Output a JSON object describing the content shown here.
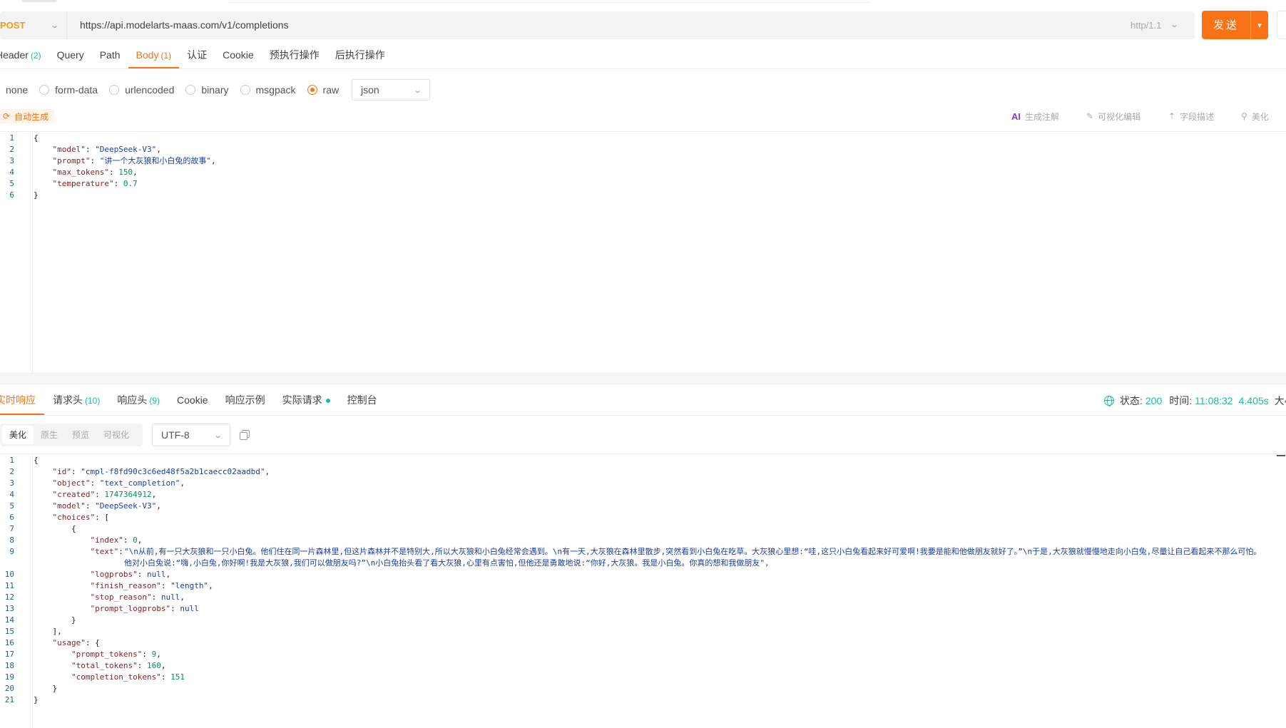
{
  "request": {
    "method": "POST",
    "url": "https://api.modelarts-maas.com/v1/completions",
    "http_version": "http/1.1",
    "send_label": "发送"
  },
  "request_tabs": [
    {
      "label": "Header",
      "count": "(2)"
    },
    {
      "label": "Query",
      "count": ""
    },
    {
      "label": "Path",
      "count": ""
    },
    {
      "label": "Body",
      "count": "(1)",
      "active": true
    },
    {
      "label": "认证",
      "count": ""
    },
    {
      "label": "Cookie",
      "count": ""
    },
    {
      "label": "预执行操作",
      "count": ""
    },
    {
      "label": "后执行操作",
      "count": ""
    }
  ],
  "body_types": [
    {
      "label": "none",
      "selected": false
    },
    {
      "label": "form-data",
      "selected": false
    },
    {
      "label": "urlencoded",
      "selected": false
    },
    {
      "label": "binary",
      "selected": false
    },
    {
      "label": "msgpack",
      "selected": false
    },
    {
      "label": "raw",
      "selected": true
    }
  ],
  "raw_format": "json",
  "editor_toolbar": {
    "auto_generate": "自动生成",
    "ai_mark": "AI",
    "generate_comment": "生成注解",
    "visual_edit": "可视化编辑",
    "field_desc": "字段描述",
    "beautify": "美化"
  },
  "request_body": {
    "line_numbers": [
      "1",
      "2",
      "3",
      "4",
      "5",
      "6"
    ],
    "model_key": "\"model\"",
    "model_val": "\"DeepSeek-V3\"",
    "prompt_key": "\"prompt\"",
    "prompt_val": "\"讲一个大灰狼和小白兔的故事\"",
    "max_tokens_key": "\"max_tokens\"",
    "max_tokens_val": "150",
    "temperature_key": "\"temperature\"",
    "temperature_val": "0.7"
  },
  "response_tabs": [
    {
      "label": "实时响应",
      "count": "",
      "active": true
    },
    {
      "label": "请求头",
      "count": "(10)"
    },
    {
      "label": "响应头",
      "count": "(9)"
    },
    {
      "label": "Cookie",
      "count": ""
    },
    {
      "label": "响应示例",
      "count": ""
    },
    {
      "label": "实际请求",
      "count": "",
      "dot": true
    },
    {
      "label": "控制台",
      "count": ""
    }
  ],
  "status": {
    "status_label": "状态:",
    "status_code": "200",
    "time_label": "时间:",
    "time_value": "11:08:32",
    "duration": "4.405s",
    "size_label": "大小"
  },
  "view_modes": [
    {
      "label": "美化",
      "active": true
    },
    {
      "label": "原生",
      "active": false
    },
    {
      "label": "预览",
      "active": false
    },
    {
      "label": "可视化",
      "active": false
    }
  ],
  "encoding": "UTF-8",
  "response_body": {
    "line_numbers": [
      "1",
      "2",
      "3",
      "4",
      "5",
      "6",
      "7",
      "8",
      "9",
      "10",
      "11",
      "12",
      "13",
      "14",
      "15",
      "16",
      "17",
      "18",
      "19",
      "20",
      "21"
    ],
    "id_key": "\"id\"",
    "id_val": "\"cmpl-f8fd90c3c6ed48f5a2b1caecc02aadbd\"",
    "object_key": "\"object\"",
    "object_val": "\"text_completion\"",
    "created_key": "\"created\"",
    "created_val": "1747364912",
    "model_key": "\"model\"",
    "model_val": "\"DeepSeek-V3\"",
    "choices_key": "\"choices\"",
    "index_key": "\"index\"",
    "index_val": "0",
    "text_key": "\"text\"",
    "text_val": "\"\\n从前,有一只大灰狼和一只小白兔。他们住在同一片森林里,但这片森林并不是特别大,所以大灰狼和小白兔经常会遇到。\\n有一天,大灰狼在森林里散步,突然看到小白兔在吃草。大灰狼心里想:“哇,这只小白兔看起来好可爱啊!我要是能和他做朋友就好了。”\\n于是,大灰狼就慢慢地走向小白兔,尽量让自己看起来不那么可怕。他对小白兔说:“嗨,小白兔,你好啊!我是大灰狼,我们可以做朋友吗?”\\n小白兔抬头看了看大灰狼,心里有点害怕,但他还是勇敢地说:“你好,大灰狼。我是小白兔。你真的想和我做朋友\",",
    "logprobs_key": "\"logprobs\"",
    "logprobs_val": "null",
    "finish_key": "\"finish_reason\"",
    "finish_val": "\"length\"",
    "stop_key": "\"stop_reason\"",
    "stop_val": "null",
    "prompt_logprobs_key": "\"prompt_logprobs\"",
    "prompt_logprobs_val": "null",
    "usage_key": "\"usage\"",
    "prompt_tokens_key": "\"prompt_tokens\"",
    "prompt_tokens_val": "9",
    "total_tokens_key": "\"total_tokens\"",
    "total_tokens_val": "160",
    "completion_tokens_key": "\"completion_tokens\"",
    "completion_tokens_val": "151"
  },
  "colors": {
    "accent": "#f97316",
    "success": "#1abc9c",
    "ai": "#7c3aed"
  }
}
